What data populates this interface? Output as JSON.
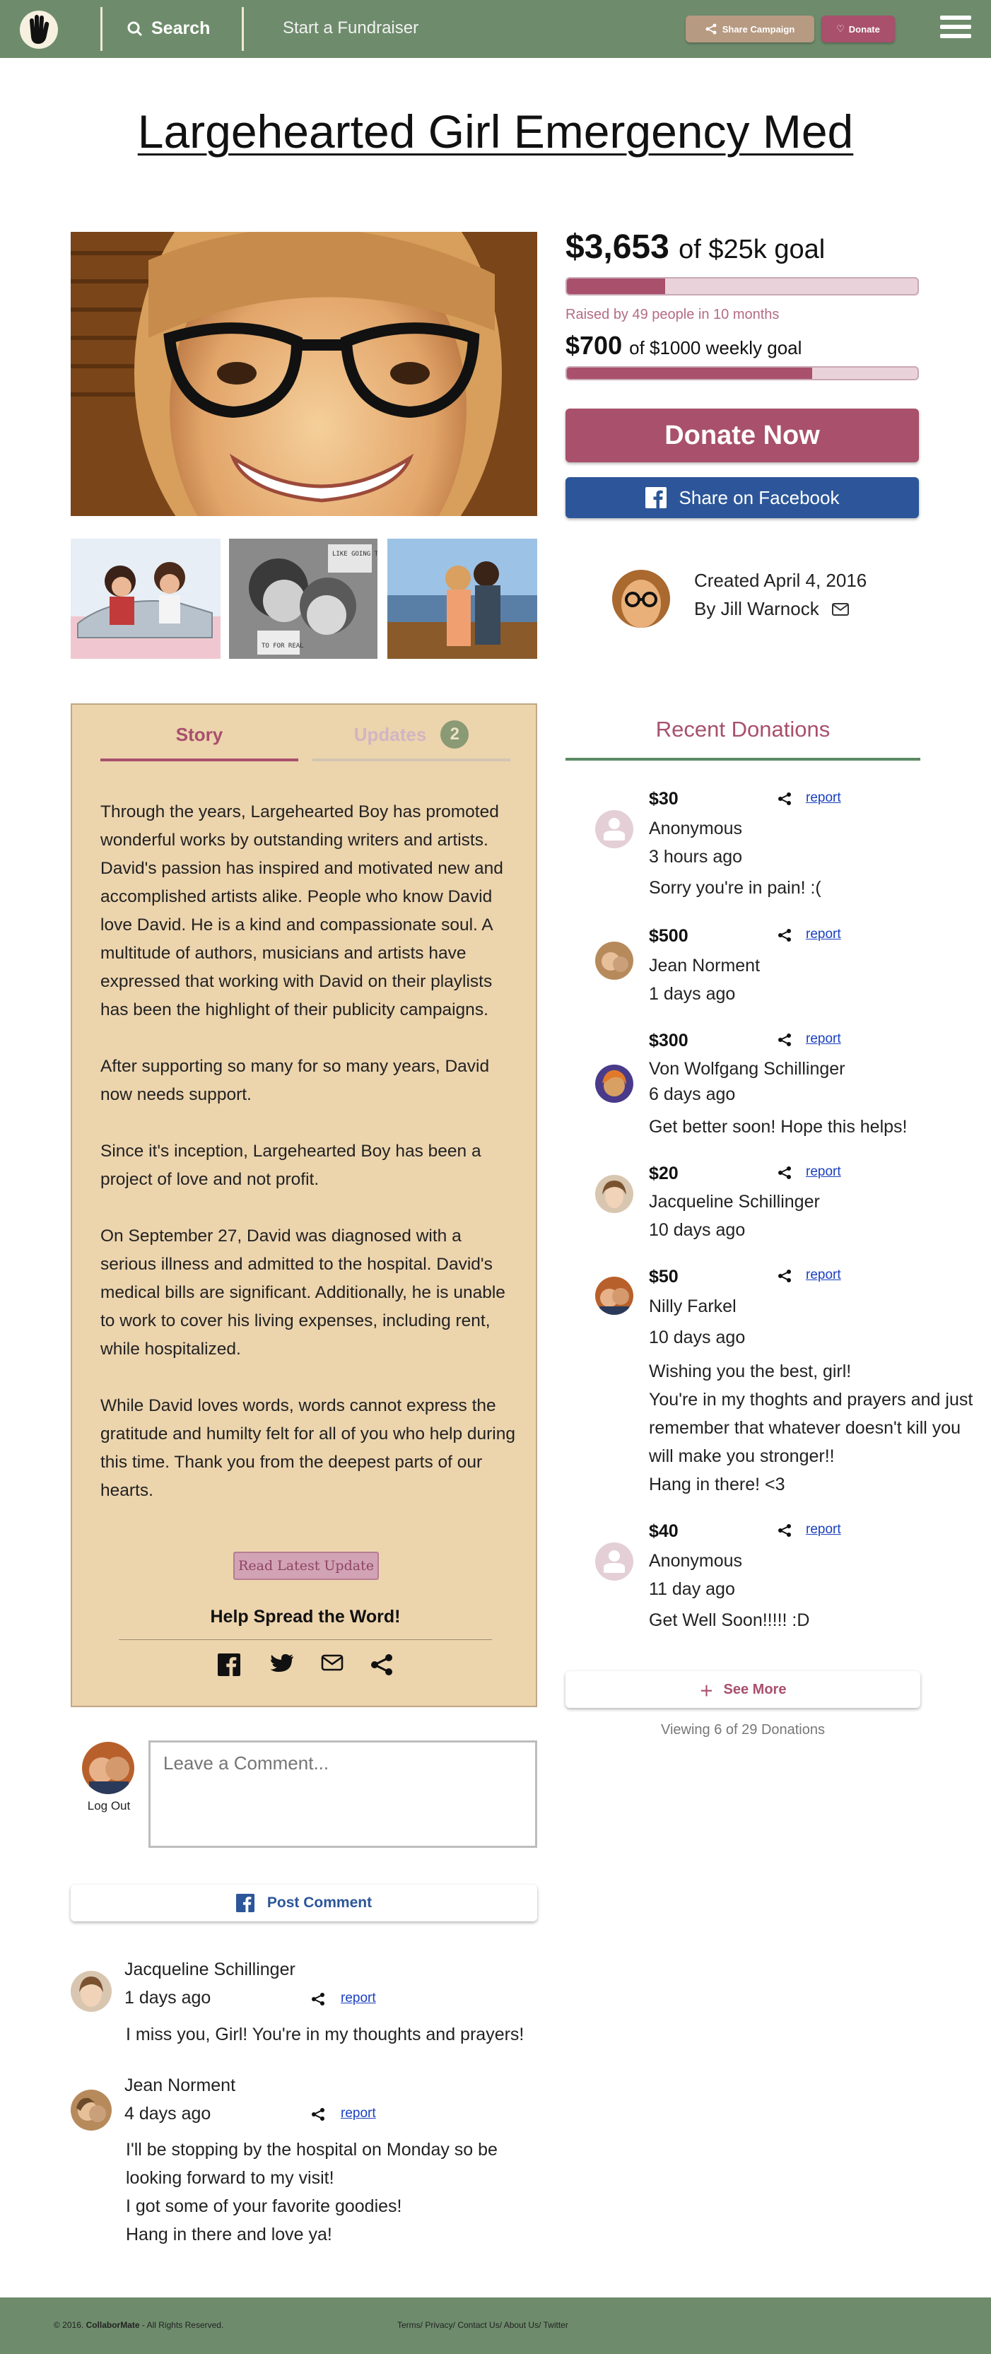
{
  "header": {
    "search_label": "Search",
    "start_label": "Start a Fundraiser",
    "share_label": "Share Campaign",
    "donate_label": "Donate"
  },
  "campaign": {
    "title": "Largehearted Girl Emergency Med",
    "raised": "$3,653",
    "goal_text": "of $25k goal",
    "goal_progress": 0.28,
    "raised_note": "Raised by 49 people in 10 months",
    "weekly_amount": "$700",
    "weekly_goal_text": "of $1000 weekly goal",
    "weekly_progress": 0.7,
    "donate_button": "Donate Now",
    "facebook_button": "Share on Facebook",
    "created": "Created April 4, 2016",
    "by": "By Jill Warnock"
  },
  "thumbs": {
    "thumb2_caption_top": "LIKE GOING TO GUT",
    "thumb2_caption_bottom": "TO FOR REAL"
  },
  "tabs": {
    "story": "Story",
    "updates": "Updates",
    "updates_count": "2"
  },
  "story": {
    "paragraphs": [
      "Through the years,  Largehearted Boy has promoted wonderful works by outstanding writers and artists. David's passion has inspired and motivated new and accomplished artists alike. People who know David love David. He is a kind and compassionate soul. A multitude of authors, musicians and artists have expressed that working with David on their playlists has been the highlight of their publicity campaigns.",
      "After supporting so many for so many years, David now needs support.",
      "Since it's inception, Largehearted Boy has been a project of love and not profit.",
      "On September 27, David was diagnosed with a serious illness and admitted to the hospital. David's medical bills are significant. Additionally, he is unable to work to cover his living expenses, including rent, while hospitalized.",
      "While David loves words, words cannot express the gratitude and humilty felt for all of you who help during this time. Thank you from the deepest parts of our hearts."
    ],
    "read_update": "Read Latest Update",
    "spread": "Help Spread the Word!"
  },
  "comment_form": {
    "logout": "Log Out",
    "placeholder": "Leave a Comment...",
    "post_button": "Post Comment"
  },
  "comments": [
    {
      "name": "Jacqueline Schillinger",
      "time": "1 days ago",
      "report": "report",
      "lines": [
        "I miss you, Girl! You're in my thoughts and prayers!"
      ]
    },
    {
      "name": "Jean Norment",
      "time": "4 days ago",
      "report": "report",
      "lines": [
        "I'll be stopping by the hospital on Monday so be",
        "looking forward to my visit!",
        "I got some of your favorite goodies!",
        "Hang in there and love ya!"
      ]
    }
  ],
  "recent": {
    "title": "Recent Donations",
    "donations": [
      {
        "amount": "$30",
        "name": "Anonymous",
        "time": "3 hours ago",
        "message": "Sorry you're in pain! :(",
        "report": "report"
      },
      {
        "amount": "$500",
        "name": "Jean Norment",
        "time": "1 days ago",
        "message": "",
        "report": "report"
      },
      {
        "amount": "$300",
        "name": "Von Wolfgang Schillinger",
        "time": "6 days ago",
        "message": "Get better soon! Hope this helps!",
        "report": "report"
      },
      {
        "amount": "$20",
        "name": "Jacqueline Schillinger",
        "time": "10 days ago",
        "message": "",
        "report": "report"
      },
      {
        "amount": "$50",
        "name": "Nilly Farkel",
        "time": "10 days ago",
        "message": "Wishing you the best, girl!\nYou're in my thoghts and prayers and just remember that whatever doesn't kill you will make you  stronger!!\nHang in there! <3",
        "report": "report"
      },
      {
        "amount": "$40",
        "name": "Anonymous",
        "time": "11 day ago",
        "message": "Get Well Soon!!!!! :D",
        "report": "report"
      }
    ],
    "see_more": "See More",
    "viewing": "Viewing 6 of 29 Donations"
  },
  "footer": {
    "year": "© 2016.",
    "brand": "CollaborMate",
    "rights": "- All Rights Reserved.",
    "links": "Terms/ Privacy/ Contact Us/ About Us/ Twitter"
  },
  "colors": {
    "header": "#6e8c6c",
    "accent": "#a8506c",
    "facebook": "#2c5699",
    "story_bg": "#ecd4ad"
  }
}
